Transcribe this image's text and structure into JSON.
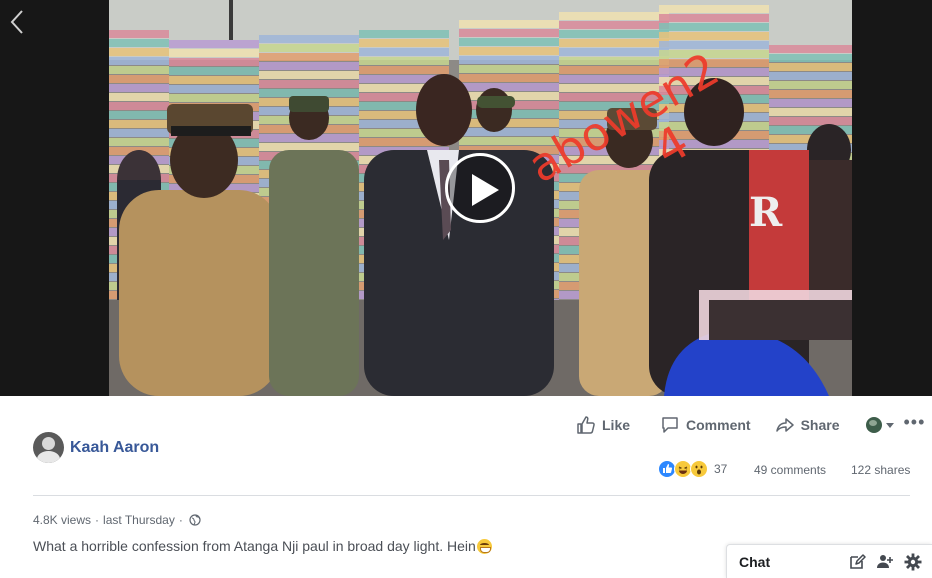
{
  "video": {
    "watermark_line1": "abowen2",
    "watermark_line2": "4"
  },
  "post": {
    "author_name": "Kaah Aaron",
    "actions": {
      "like": "Like",
      "comment": "Comment",
      "share": "Share"
    },
    "reaction_count": "37",
    "comments_count": "49 comments",
    "shares_count": "122 shares",
    "views": "4.8K views",
    "meta_separator": "·",
    "date": "last Thursday",
    "caption": "What a horrible confession from Atanga Nji paul in broad day light. Hein"
  },
  "chat": {
    "label": "Chat"
  },
  "colors": {
    "author_link": "#385898",
    "secondary_text": "#606770",
    "like_blue": "#2d88ff",
    "watermark_red": "#ee3b2b"
  }
}
